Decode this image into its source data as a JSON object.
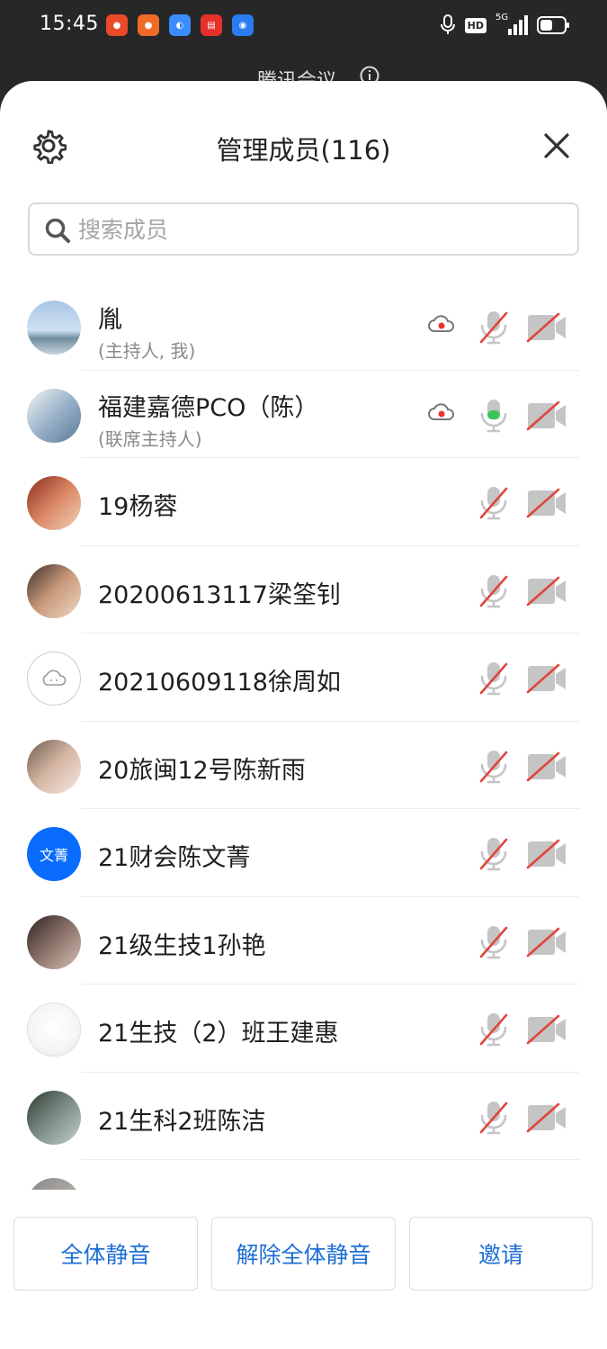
{
  "status_bar": {
    "time": "15:45",
    "badge_hd": "HD",
    "badge_5g": "5G"
  },
  "background_window": {
    "title": "腾讯会议"
  },
  "sheet": {
    "title": "管理成员(116)",
    "search_placeholder": "搜索成员"
  },
  "members": [
    {
      "name": "胤",
      "role": "(主持人, 我)",
      "recording": true,
      "mic": "muted",
      "camera": "off",
      "avatar": "sky-photo"
    },
    {
      "name": "福建嘉德PCO（陈）",
      "role": "(联席主持人)",
      "recording": true,
      "mic": "on",
      "camera": "off",
      "avatar": "illustration"
    },
    {
      "name": "19杨蓉",
      "role": "",
      "recording": false,
      "mic": "muted",
      "camera": "off",
      "avatar": "photo"
    },
    {
      "name": "20200613117梁筌钊",
      "role": "",
      "recording": false,
      "mic": "muted",
      "camera": "off",
      "avatar": "photo"
    },
    {
      "name": "20210609118徐周如",
      "role": "",
      "recording": false,
      "mic": "muted",
      "camera": "off",
      "avatar": "default"
    },
    {
      "name": "20旅闽12号陈新雨",
      "role": "",
      "recording": false,
      "mic": "muted",
      "camera": "off",
      "avatar": "photo"
    },
    {
      "name": "21财会陈文菁",
      "role": "",
      "recording": false,
      "mic": "muted",
      "camera": "off",
      "avatar": "text",
      "avatar_text": "文菁"
    },
    {
      "name": "21级生技1孙艳",
      "role": "",
      "recording": false,
      "mic": "muted",
      "camera": "off",
      "avatar": "photo"
    },
    {
      "name": "21生技（2）班王建惠",
      "role": "",
      "recording": false,
      "mic": "muted",
      "camera": "off",
      "avatar": "duck"
    },
    {
      "name": "21生科2班陈洁",
      "role": "",
      "recording": false,
      "mic": "muted",
      "camera": "off",
      "avatar": "photo"
    }
  ],
  "footer": {
    "mute_all": "全体静音",
    "unmute_all": "解除全体静音",
    "invite": "邀请"
  },
  "colors": {
    "accent": "#1f6fd6",
    "muted_slash": "#e0463c",
    "mic_on": "#3cc35a",
    "record_dot": "#f0322d",
    "avatar_text_bg": "#0a6cff"
  }
}
